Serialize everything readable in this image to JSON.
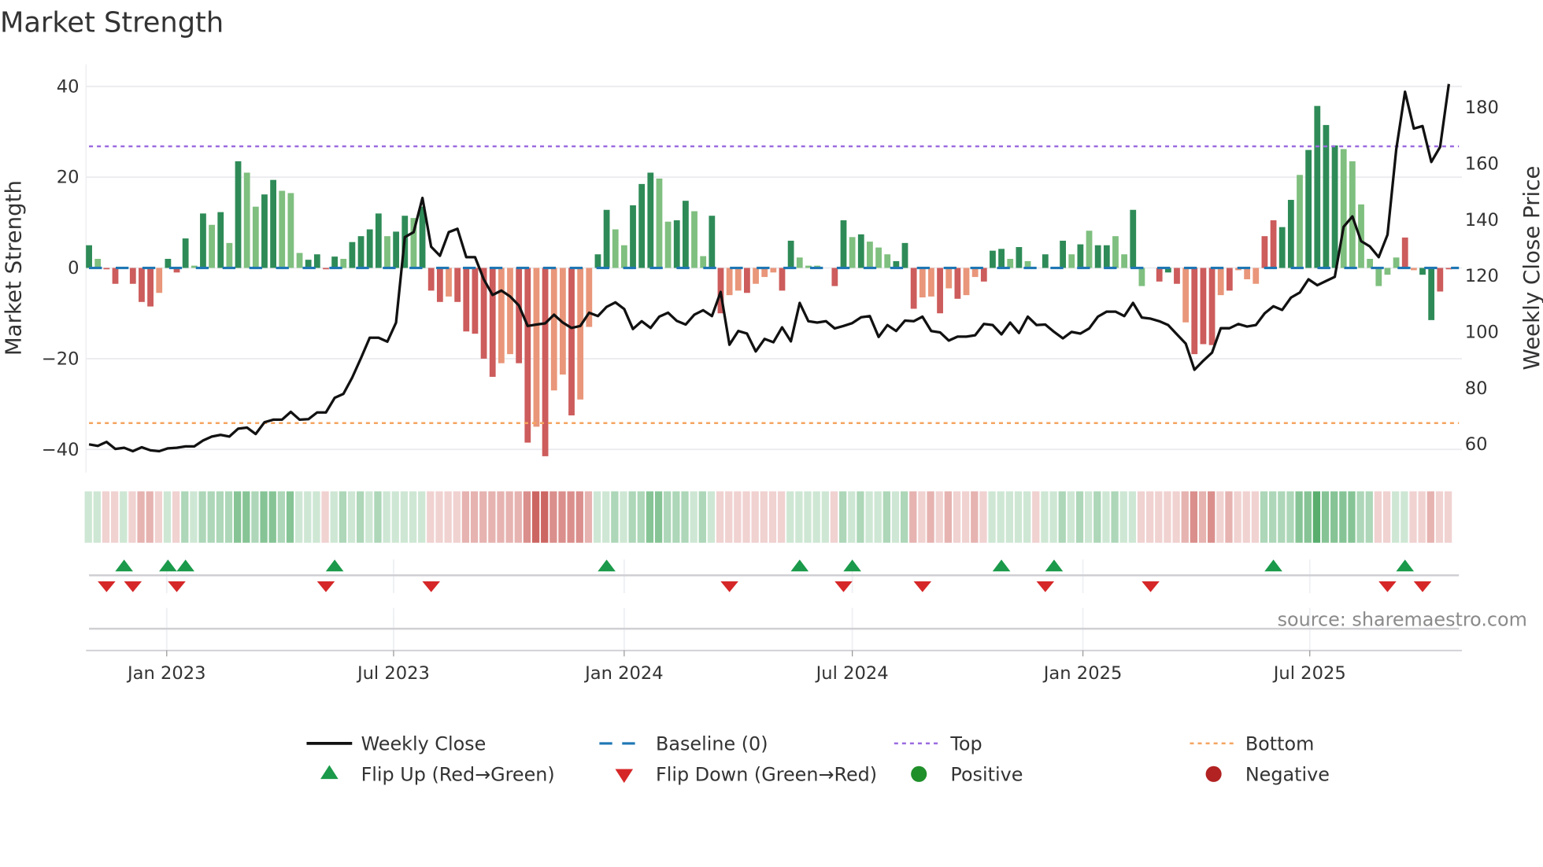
{
  "title": "Market Strength",
  "source_note": "source: sharemaestro.com",
  "legend": {
    "weekly_close": "Weekly Close",
    "baseline": "Baseline (0)",
    "top": "Top",
    "bottom": "Bottom",
    "flip_up": "Flip Up (Red→Green)",
    "flip_down": "Flip Down (Green→Red)",
    "positive": "Positive",
    "negative": "Negative"
  },
  "colors": {
    "bar_strong_pos": "#2e8b57",
    "bar_weak_pos": "#7fbf7f",
    "bar_strong_neg": "#cd5c5c",
    "bar_weak_neg": "#e9967a",
    "price_line": "#111111",
    "baseline": "#1f77b4",
    "top": "#9b6be0",
    "bottom": "#f4a460",
    "flip_up": "#1a9a4a",
    "flip_down": "#d62728",
    "positive": "#1f8f2a",
    "negative": "#b22222",
    "strip_pos": "60,160,85",
    "strip_neg": "195,75,70",
    "grid": "#ececf0"
  },
  "chart_data": {
    "type": "bar",
    "title": "Market Strength",
    "x_start": "2022-10-31",
    "x_freq_days": 7,
    "ylabel": "Market Strength",
    "ylabel_right": "Weekly Close Price",
    "ylim": [
      -44,
      44
    ],
    "ylim_right": [
      53.5,
      185.8
    ],
    "yticks": [
      40,
      20,
      0,
      -20,
      -40
    ],
    "yticks_labels": [
      "40",
      "20",
      "0",
      "−20",
      "−40"
    ],
    "yticks_right": [
      180,
      160,
      140,
      120,
      100,
      80,
      60
    ],
    "yticks_right_labels": [
      "180",
      "160",
      "140",
      "120",
      "100",
      "80",
      "60"
    ],
    "xticks": [
      {
        "date": "2023-01-01",
        "label": "Jan 2023"
      },
      {
        "date": "2023-07-01",
        "label": "Jul 2023"
      },
      {
        "date": "2024-01-01",
        "label": "Jan 2024"
      },
      {
        "date": "2024-07-01",
        "label": "Jul 2024"
      },
      {
        "date": "2025-01-01",
        "label": "Jan 2025"
      },
      {
        "date": "2025-07-01",
        "label": "Jul 2025"
      }
    ],
    "top_level": 26.8,
    "bottom_level": -34.2,
    "baseline": 0,
    "legend_position": "bottom",
    "strength": [
      5,
      2,
      -0.3,
      -3.5,
      0,
      -3.5,
      -7.5,
      -8.5,
      -5.5,
      2,
      -1,
      6.5,
      0.5,
      12,
      9.5,
      12.3,
      5.5,
      23.5,
      21,
      13.5,
      16.2,
      19.4,
      17,
      16.5,
      3.3,
      1.8,
      3,
      -0.3,
      2.5,
      2,
      5.7,
      7,
      8.5,
      12,
      7,
      8,
      11.5,
      11,
      13.5,
      -5,
      -7.5,
      -6.3,
      -7.5,
      -14,
      -14.5,
      -20,
      -24,
      -21,
      -19,
      -21,
      -38.5,
      -35,
      -41.5,
      -27,
      -23.5,
      -32.5,
      -29,
      -13,
      3,
      12.8,
      8.5,
      5,
      13.8,
      18.5,
      21,
      19.7,
      10.2,
      10.5,
      14.8,
      12.5,
      2.6,
      11.5,
      -10,
      -6,
      -5,
      -5.5,
      -3.5,
      -2,
      -1,
      -5,
      6,
      2.3,
      0.5,
      0.5,
      0,
      -4,
      10.5,
      6.8,
      7.4,
      5.8,
      4.5,
      3,
      1.5,
      5.5,
      -9,
      -6.5,
      -6.3,
      -10,
      -4.5,
      -6.8,
      -6,
      -2,
      -3,
      3.8,
      4.2,
      2,
      4.6,
      1.5,
      0,
      3,
      0,
      6,
      3,
      5.2,
      8.2,
      5,
      5,
      7,
      3,
      12.8,
      -4,
      0,
      -3,
      -1,
      -3.5,
      -12,
      -19,
      -16.8,
      -17,
      -6,
      -5,
      -0.5,
      -2.5,
      -3.5,
      7,
      10.5,
      9,
      15,
      20.5,
      26,
      35.7,
      31.5,
      27,
      26.2,
      23.5,
      14,
      2,
      -4,
      -1.5,
      2.3,
      6.7,
      -0.5,
      -1.5,
      -11.5,
      -5.2,
      -0.3
    ],
    "strength_kind": "GgRRGRRRrGRGgGgGgGggGGgggGGRGgGGGGgGGgGRRrRRRRRrrRRrRrrRrrGGggGGGggGGggGRrrRrrrRGgggGRGgGgggGGRrrRrRrrRGGgGgGGGGgGgGGggGgGRGRrRRRrRrrrRRGGgGGGGgggggggRrGGRRRrR",
    "weekly_close": [
      59.6,
      59.1,
      60.5,
      58.0,
      58.4,
      57.2,
      58.6,
      57.5,
      57.2,
      58.2,
      58.4,
      58.9,
      58.9,
      61.0,
      62.4,
      63.0,
      62.4,
      65.2,
      65.6,
      63.3,
      67.5,
      68.4,
      68.4,
      71.2,
      68.4,
      68.6,
      71.0,
      71.0,
      76.2,
      77.6,
      83.4,
      90.4,
      97.6,
      97.6,
      96.2,
      103.0,
      133.4,
      135.2,
      147.4,
      130.0,
      126.8,
      135.2,
      136.4,
      126.3,
      126.3,
      118.4,
      112.8,
      114.4,
      112.3,
      109.1,
      101.8,
      102.3,
      102.7,
      105.8,
      103.0,
      101.1,
      101.8,
      106.5,
      105.3,
      108.6,
      110.2,
      107.8,
      100.7,
      103.5,
      101.1,
      105.1,
      106.5,
      103.6,
      102.3,
      105.8,
      107.4,
      105.3,
      113.9,
      95.1,
      100.0,
      99.1,
      92.7,
      97.2,
      96.0,
      101.3,
      96.3,
      110.0,
      103.5,
      103.0,
      103.5,
      100.9,
      101.8,
      102.8,
      104.9,
      105.3,
      97.9,
      102.1,
      100.0,
      103.7,
      103.5,
      105.1,
      100.0,
      99.5,
      96.6,
      98.0,
      98.0,
      98.5,
      102.5,
      102.1,
      98.8,
      103.0,
      99.3,
      105.1,
      102.1,
      102.3,
      99.7,
      97.4,
      99.7,
      99.1,
      100.9,
      105.1,
      106.9,
      106.9,
      105.3,
      110.0,
      104.8,
      104.4,
      103.5,
      102.1,
      98.8,
      95.5,
      86.2,
      89.4,
      92.3,
      101.0,
      101.0,
      102.5,
      101.6,
      102.1,
      106.3,
      108.8,
      107.5,
      111.9,
      113.7,
      118.4,
      116.3,
      117.8,
      119.3,
      137.1,
      140.8,
      132.0,
      130.1,
      126.3,
      134.3,
      164.6,
      185.2,
      172.1,
      173.0,
      160.2,
      165.6,
      188.0
    ],
    "regime_strip": [
      1,
      1,
      -1,
      -1,
      1,
      -1,
      -2,
      -2,
      -1,
      1,
      -1,
      2,
      1,
      2,
      2,
      2,
      2,
      3,
      3,
      2,
      3,
      3,
      2,
      3,
      1,
      1,
      1,
      -1,
      1,
      2,
      1,
      2,
      1,
      2,
      1,
      1,
      1,
      1,
      1,
      -1,
      -1,
      -1,
      -1,
      -2,
      -2,
      -2,
      -2,
      -2,
      -2,
      -2,
      -3,
      -4,
      -4,
      -3,
      -3,
      -3,
      -3,
      -2,
      1,
      1,
      2,
      1,
      2,
      2,
      3,
      3,
      2,
      2,
      2,
      1,
      2,
      1,
      -1,
      -1,
      -1,
      -1,
      -1,
      -1,
      -1,
      -1,
      1,
      1,
      1,
      1,
      1,
      -1,
      2,
      1,
      2,
      1,
      1,
      2,
      1,
      2,
      -2,
      -1,
      -2,
      -1,
      -2,
      -1,
      -1,
      -2,
      -1,
      1,
      1,
      1,
      1,
      1,
      -1,
      1,
      1,
      2,
      1,
      2,
      1,
      2,
      1,
      2,
      1,
      1,
      -1,
      -1,
      -1,
      -1,
      -1,
      -2,
      -3,
      -2,
      -3,
      -1,
      -2,
      -1,
      -1,
      -1,
      2,
      2,
      2,
      2,
      3,
      3,
      4,
      3,
      3,
      3,
      3,
      2,
      2,
      -1,
      -1,
      1,
      1,
      -1,
      -1,
      -2,
      -1,
      -1
    ],
    "flip_up_weeks": [
      4,
      9,
      11,
      28,
      59,
      81,
      87,
      104,
      110,
      135,
      150
    ],
    "flip_down_weeks": [
      2,
      5,
      10,
      27,
      39,
      73,
      86,
      95,
      109,
      121,
      148,
      152
    ]
  }
}
